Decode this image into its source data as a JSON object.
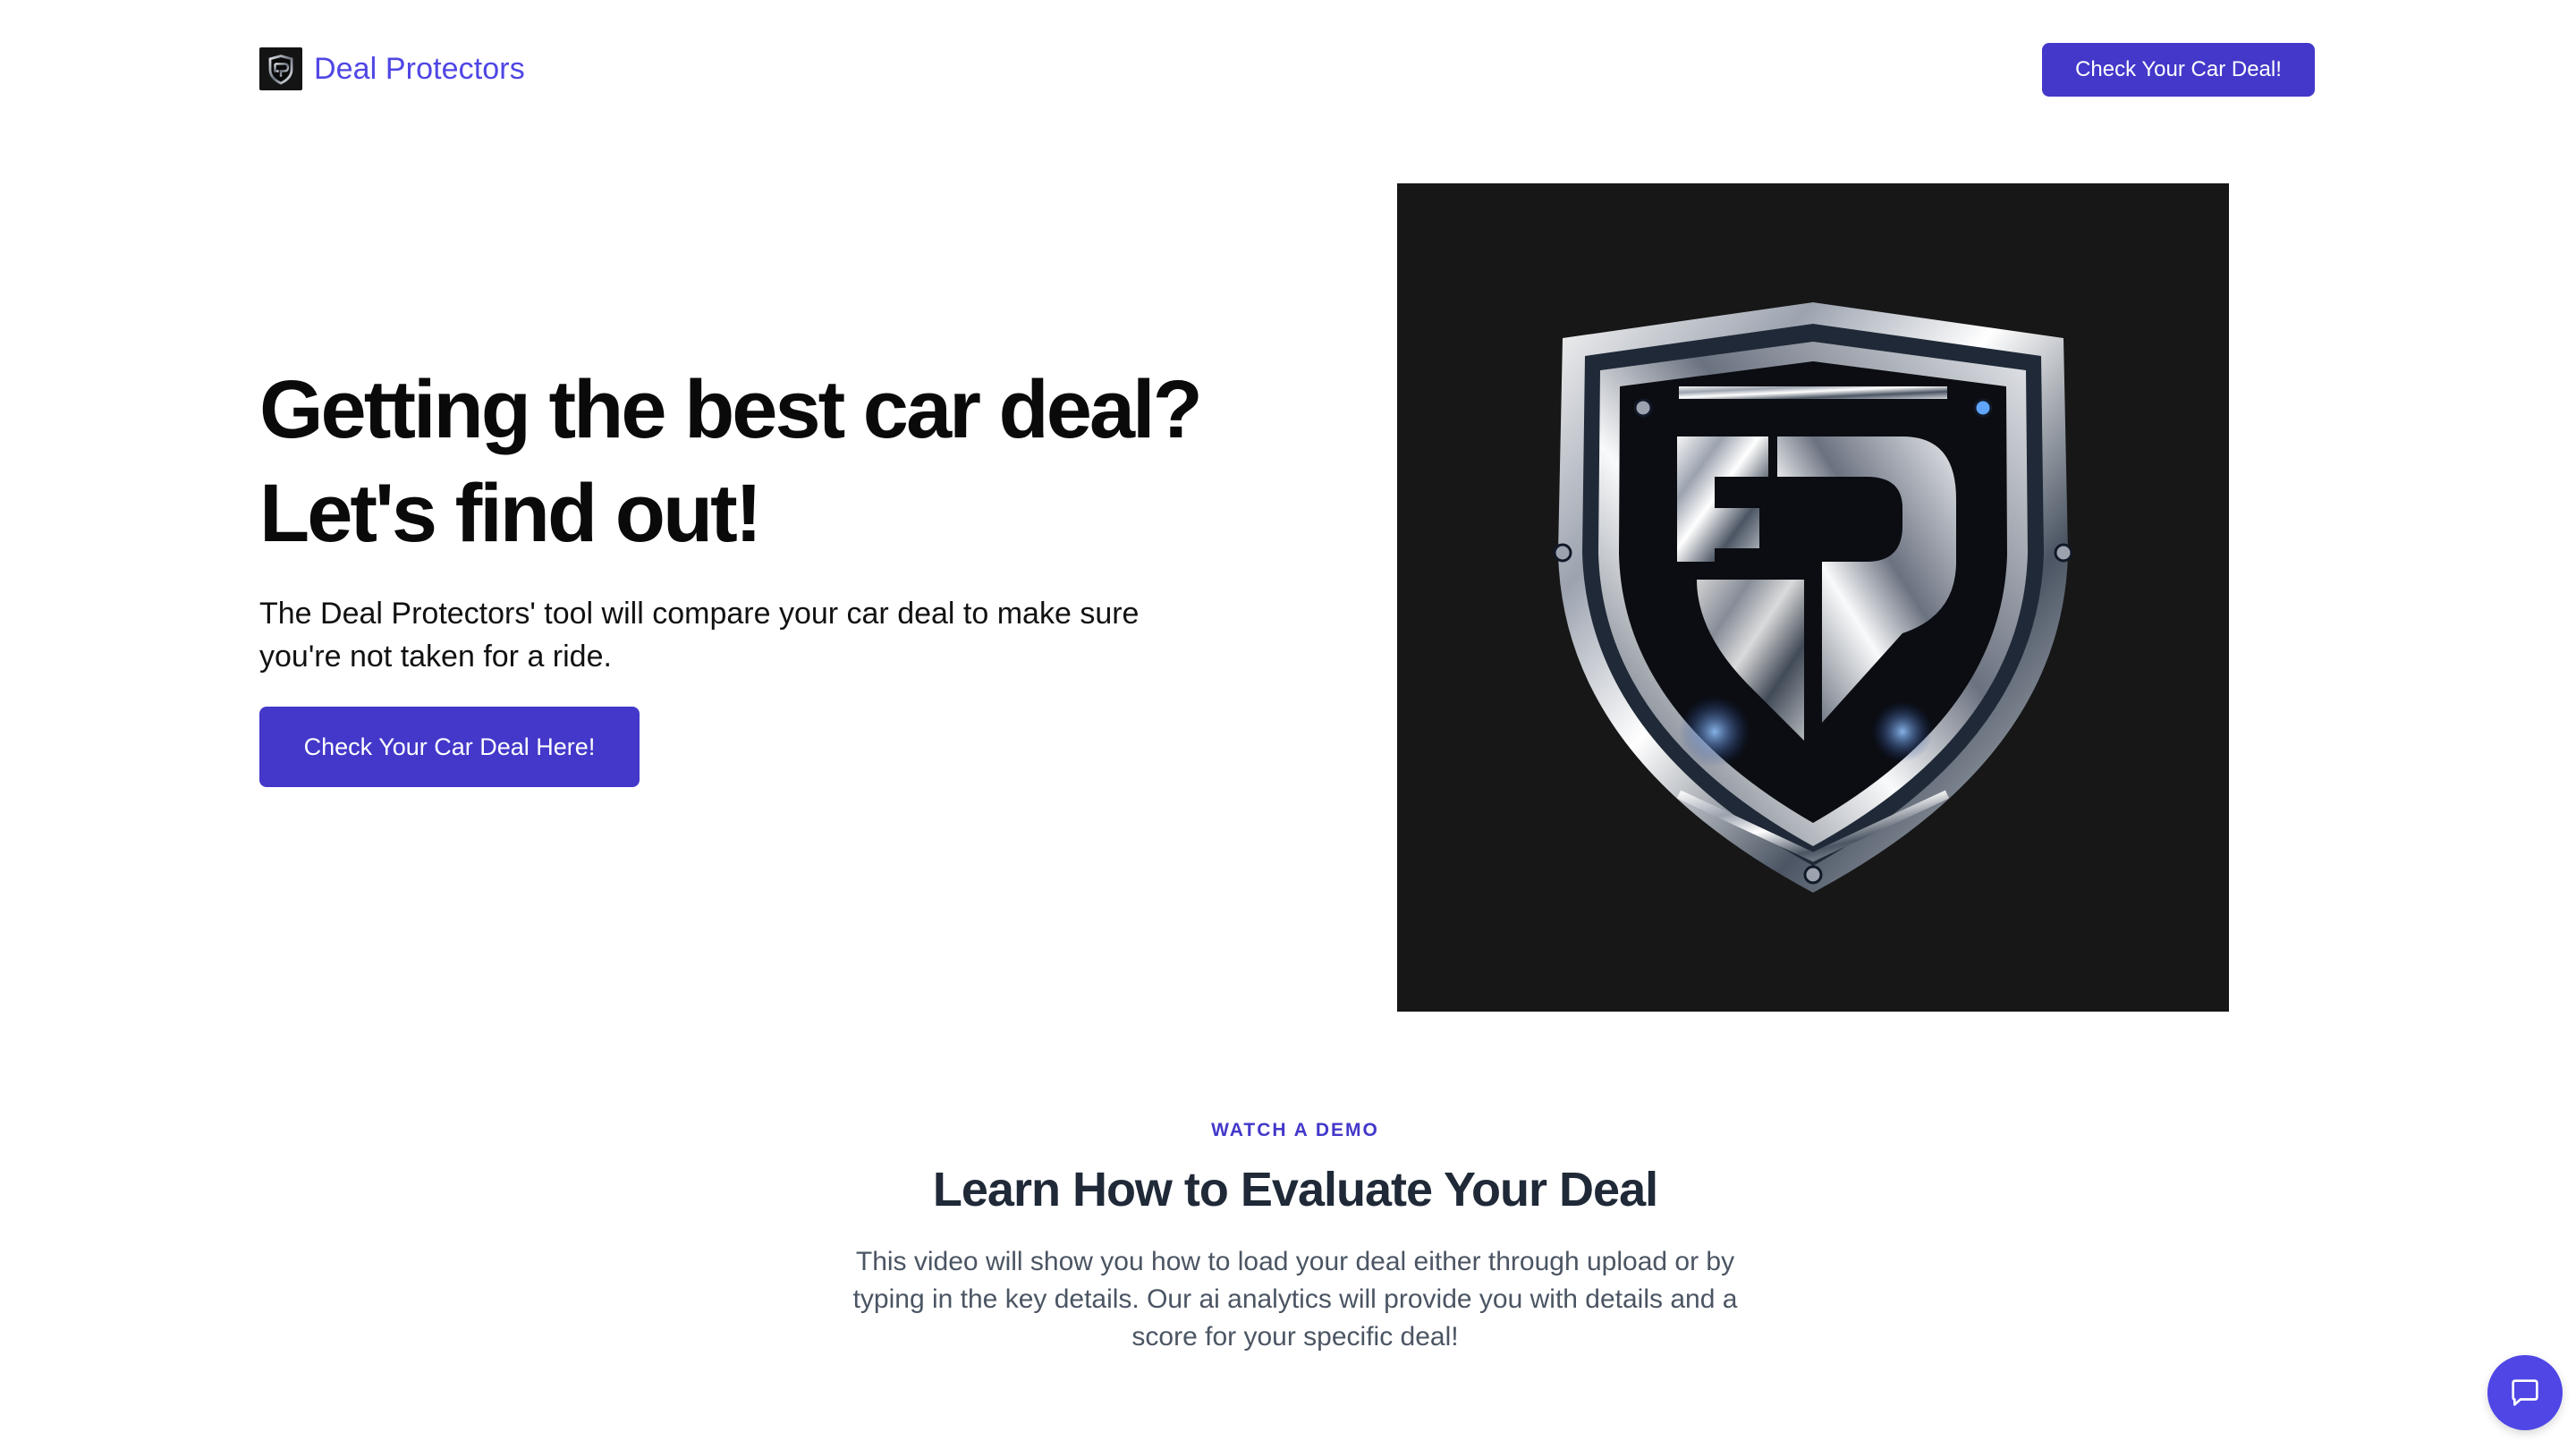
{
  "header": {
    "brand_name": "Deal Protectors",
    "logo_icon": "shield-logo-icon",
    "cta_label": "Check Your Car Deal!"
  },
  "hero": {
    "title_line1": "Getting the best car deal?",
    "title_line2": "Let's find out!",
    "description": "The Deal Protectors' tool will compare your car deal to make sure you're not taken for a ride.",
    "cta_label": "Check Your Car Deal Here!",
    "image_icon": "shield-emblem-icon"
  },
  "demo": {
    "eyebrow": "WATCH A DEMO",
    "title": "Learn How to Evaluate Your Deal",
    "description": "This video will show you how to load your deal either through upload or by typing in the key details. Our ai analytics will provide you with details and a score for your specific deal!"
  },
  "chat": {
    "icon": "chat-icon"
  },
  "colors": {
    "accent": "#4338ca",
    "brand_text": "#4f46e5",
    "hero_image_bg": "#171717",
    "muted_text": "#4b5563"
  }
}
